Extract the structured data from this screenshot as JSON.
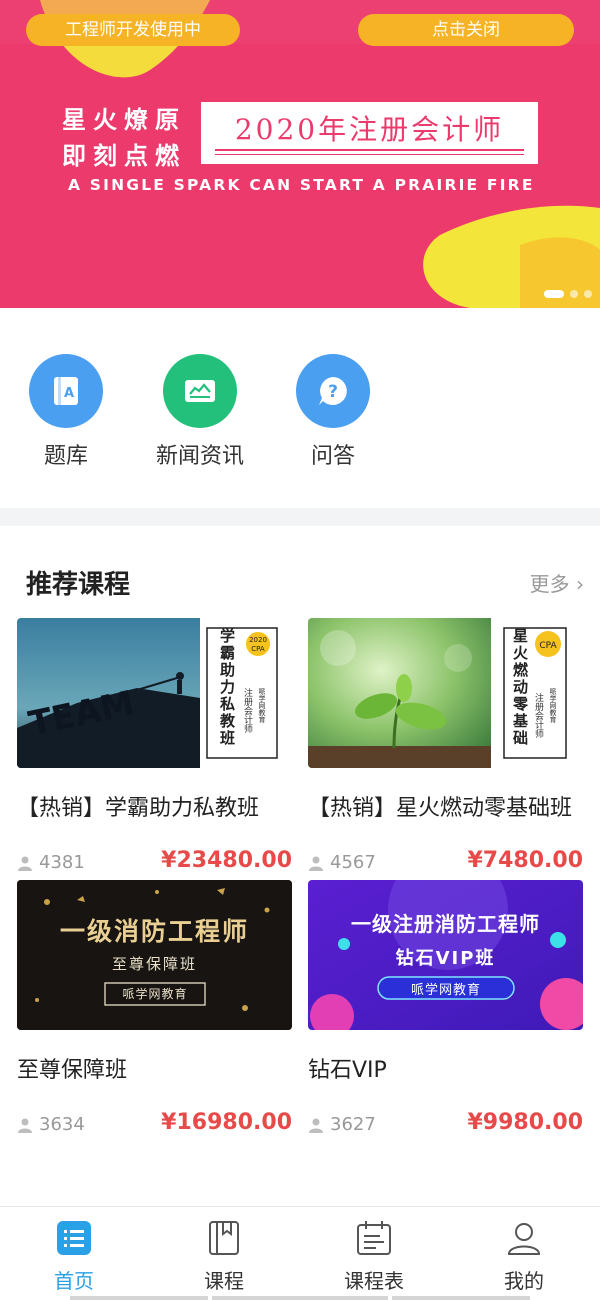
{
  "banner": {
    "dev_pill": "工程师开发使用中",
    "close_pill": "点击关闭",
    "slogan_line1": "星火燎原",
    "slogan_line2": "即刻点燃",
    "title": "2020年注册会计师",
    "subtitle": "A SINGLE SPARK CAN START A PRAIRIE FIRE",
    "colors": {
      "background": "#ec3a6d",
      "pill": "#f6b326",
      "blob": "#f4e53a"
    }
  },
  "quick_nav": [
    {
      "label": "题库",
      "icon": "question-bank-icon",
      "color": "#4a9ff0"
    },
    {
      "label": "新闻资讯",
      "icon": "news-icon",
      "color": "#22c07a"
    },
    {
      "label": "问答",
      "icon": "qa-icon",
      "color": "#4a9ff0"
    }
  ],
  "recommend": {
    "title": "推荐课程",
    "more": "更多",
    "courses": [
      {
        "name": "【热销】学霸助力私教班",
        "students": "4381",
        "price": "23480.00",
        "thumb": {
          "word": "TEAM",
          "vertical": "学霸助力私教班",
          "badge_year": "2020",
          "badge": "CPA",
          "side1": "注册会计师",
          "side2": "哌学网教育"
        }
      },
      {
        "name": "【热销】星火燃动零基础班",
        "students": "4567",
        "price": "7480.00",
        "thumb": {
          "vertical": "星火燃动零基础",
          "badge": "CPA",
          "side1": "注册会计师",
          "side2": "哌学网教育"
        }
      },
      {
        "name": "至尊保障班",
        "students": "3634",
        "price": "16980.00",
        "thumb": {
          "line1": "一级消防工程师",
          "line2": "至尊保障班",
          "line3": "哌学网教育"
        }
      },
      {
        "name": "钻石VIP",
        "students": "3627",
        "price": "9980.00",
        "thumb": {
          "line1": "一级注册消防工程师",
          "line2": "钻石VIP班",
          "line3": "哌学网教育"
        }
      }
    ],
    "currency": "¥"
  },
  "tabs": [
    {
      "label": "首页",
      "icon": "home-list-icon",
      "active": true
    },
    {
      "label": "课程",
      "icon": "book-icon",
      "active": false
    },
    {
      "label": "课程表",
      "icon": "schedule-icon",
      "active": false
    },
    {
      "label": "我的",
      "icon": "user-icon",
      "active": false
    }
  ],
  "colors": {
    "accent": "#2aa0e6",
    "price": "#e84a4a"
  }
}
